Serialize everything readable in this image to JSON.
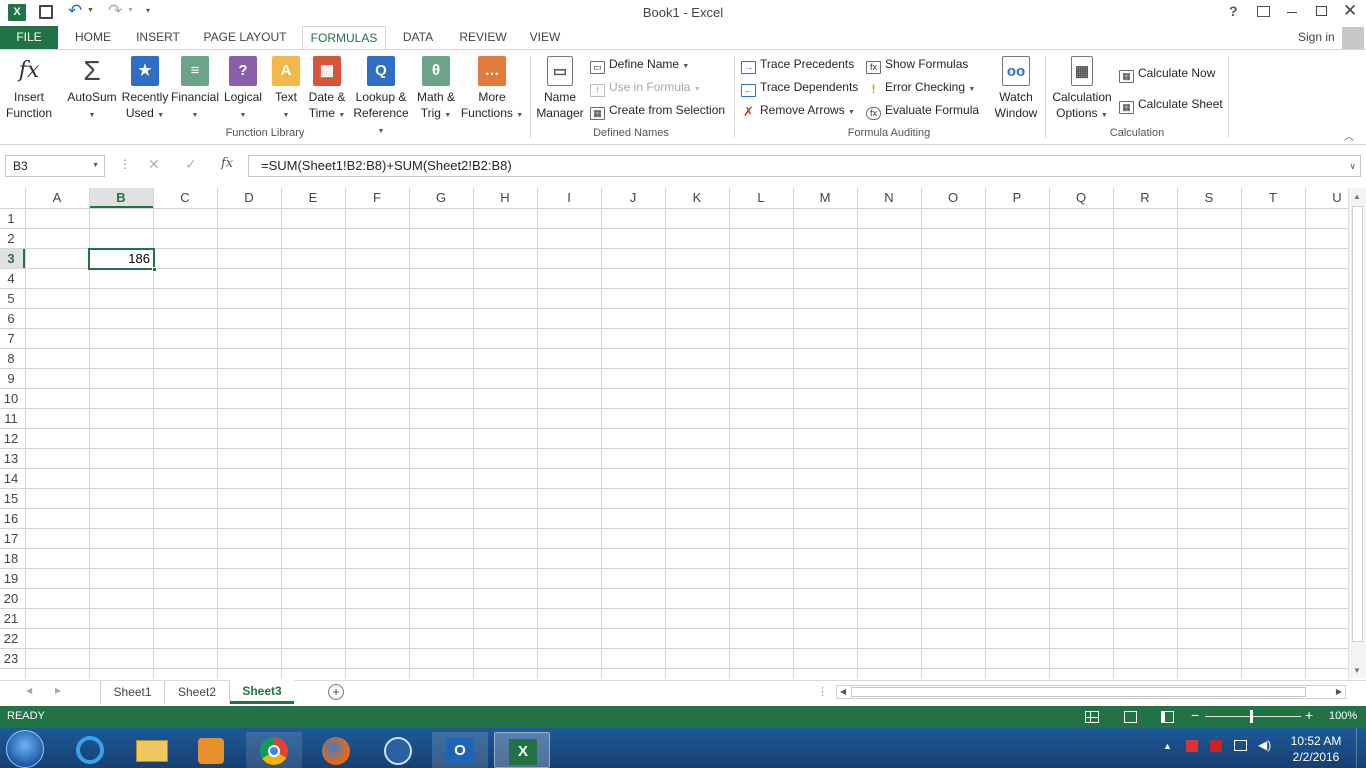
{
  "window": {
    "title": "Book1 - Excel",
    "help": "?"
  },
  "qat": {
    "app_letter": "X"
  },
  "tabs": [
    {
      "label": "FILE"
    },
    {
      "label": "HOME"
    },
    {
      "label": "INSERT"
    },
    {
      "label": "PAGE LAYOUT"
    },
    {
      "label": "FORMULAS"
    },
    {
      "label": "DATA"
    },
    {
      "label": "REVIEW"
    },
    {
      "label": "VIEW"
    }
  ],
  "signin": "Sign in",
  "ribbon": {
    "function_library": {
      "group_label": "Function Library",
      "insert_function": [
        "Insert",
        "Function"
      ],
      "autosum": "AutoSum",
      "recently_used": [
        "Recently",
        "Used"
      ],
      "financial": "Financial",
      "logical": "Logical",
      "text": "Text",
      "date_time": [
        "Date &",
        "Time"
      ],
      "lookup": [
        "Lookup &",
        "Reference"
      ],
      "math": [
        "Math &",
        "Trig"
      ],
      "more": [
        "More",
        "Functions"
      ]
    },
    "defined_names": {
      "group_label": "Defined Names",
      "name_manager": [
        "Name",
        "Manager"
      ],
      "define_name": "Define Name",
      "use_in_formula": "Use in Formula",
      "create_from_selection": "Create from Selection"
    },
    "formula_auditing": {
      "group_label": "Formula Auditing",
      "trace_precedents": "Trace Precedents",
      "trace_dependents": "Trace Dependents",
      "remove_arrows": "Remove Arrows",
      "show_formulas": "Show Formulas",
      "error_checking": "Error Checking",
      "evaluate_formula": "Evaluate Formula",
      "watch_window": [
        "Watch",
        "Window"
      ]
    },
    "calculation": {
      "group_label": "Calculation",
      "calc_options": [
        "Calculation",
        "Options"
      ],
      "calc_now": "Calculate Now",
      "calc_sheet": "Calculate Sheet"
    }
  },
  "formula_bar": {
    "name_box": "B3",
    "fx": "fx",
    "formula": "=SUM(Sheet1!B2:B8)+SUM(Sheet2!B2:B8)"
  },
  "grid": {
    "columns": [
      "A",
      "B",
      "C",
      "D",
      "E",
      "F",
      "G",
      "H",
      "I",
      "J",
      "K",
      "L",
      "M",
      "N",
      "O",
      "P",
      "Q",
      "R",
      "S",
      "T",
      "U"
    ],
    "rows": [
      "1",
      "2",
      "3",
      "4",
      "5",
      "6",
      "7",
      "8",
      "9",
      "10",
      "11",
      "12",
      "13",
      "14",
      "15",
      "16",
      "17",
      "18",
      "19",
      "20",
      "21",
      "22",
      "23"
    ],
    "active_cell": {
      "ref": "B3",
      "value": "186"
    }
  },
  "sheets": [
    {
      "label": "Sheet1"
    },
    {
      "label": "Sheet2"
    },
    {
      "label": "Sheet3",
      "active": true
    }
  ],
  "status": {
    "mode": "READY",
    "zoom": "100%"
  },
  "taskbar": {
    "time": "10:52 AM",
    "date": "2/2/2016"
  },
  "colors": {
    "excel_green": "#217346",
    "accent_blue": "#2e6fc5"
  }
}
